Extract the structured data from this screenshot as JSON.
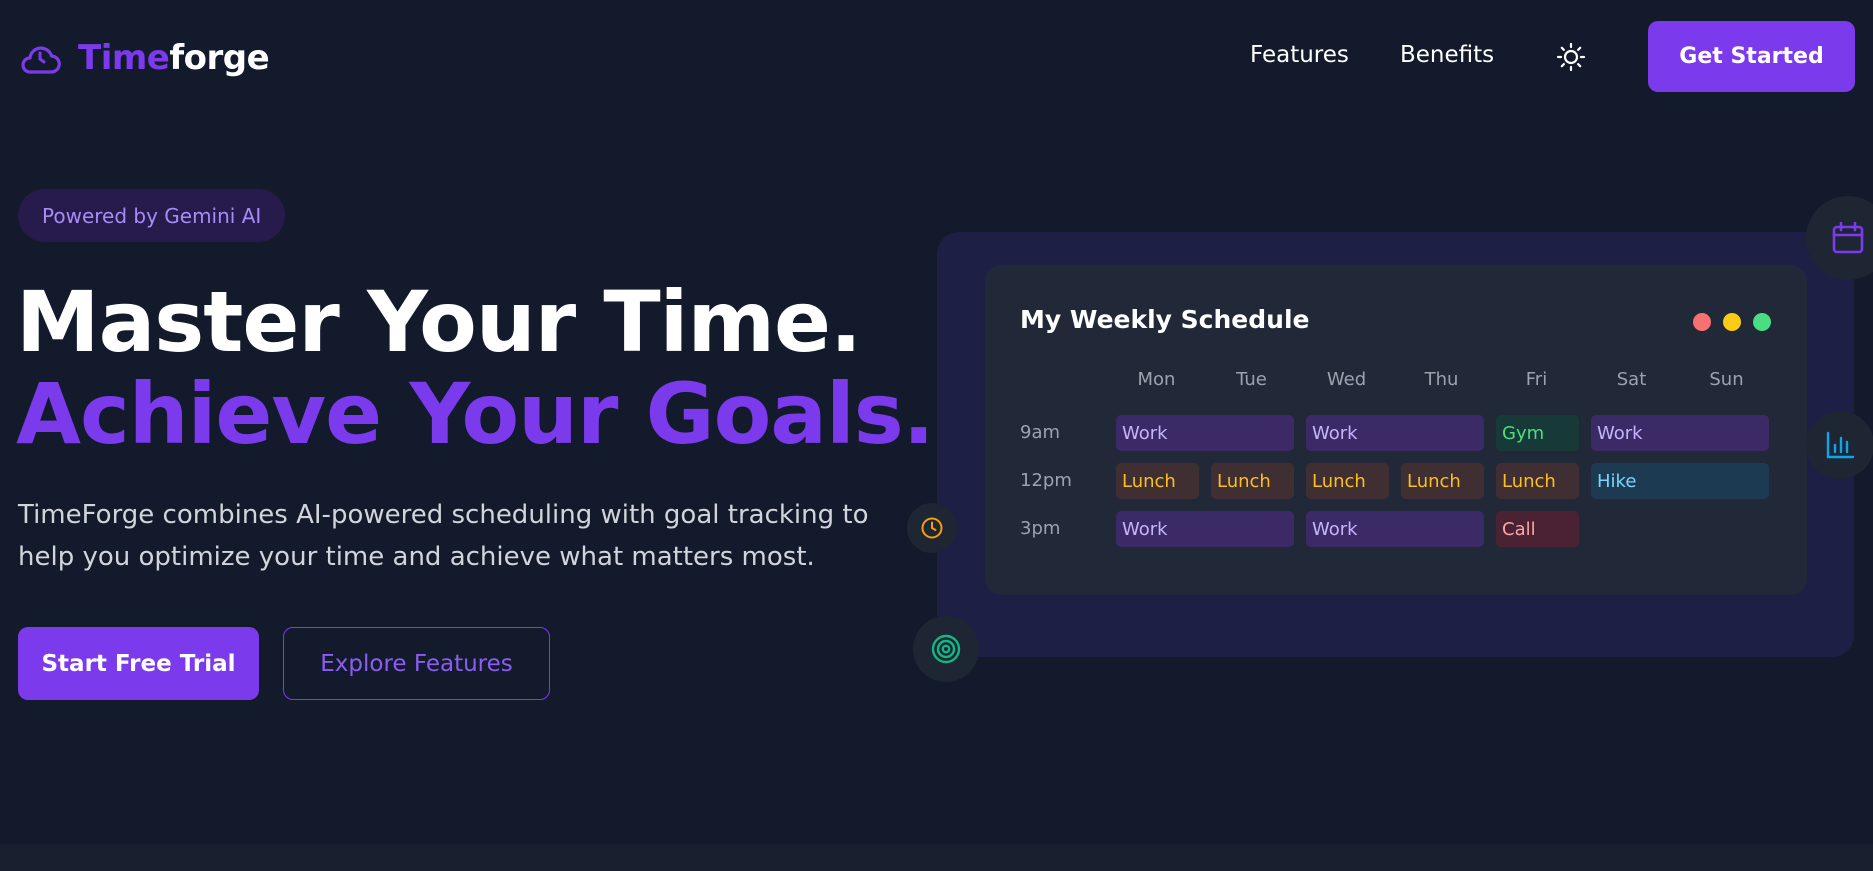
{
  "nav": {
    "logo_part1": "Time",
    "logo_part2": "forge",
    "links": [
      "Features",
      "Benefits"
    ],
    "cta_label": "Get Started"
  },
  "hero": {
    "badge": "Powered by Gemini AI",
    "headline_line1": "Master Your Time.",
    "headline_line2": "Achieve Your Goals.",
    "subtitle": "TimeForge combines AI-powered scheduling with goal tracking to help you optimize your time and achieve what matters most.",
    "primary_button": "Start Free Trial",
    "secondary_button": "Explore Features"
  },
  "schedule": {
    "title": "My Weekly Schedule",
    "days": [
      "Mon",
      "Tue",
      "Wed",
      "Thu",
      "Fri",
      "Sat",
      "Sun"
    ],
    "times": [
      "9am",
      "12pm",
      "3pm"
    ],
    "events": {
      "work_mon_tue_9": "Work",
      "work_wed_thu_9": "Work",
      "gym_fri_9": "Gym",
      "work_sat_sun_9": "Work",
      "lunch_mon": "Lunch",
      "lunch_tue": "Lunch",
      "lunch_wed": "Lunch",
      "lunch_thu": "Lunch",
      "lunch_fri": "Lunch",
      "hike_sat_sun": "Hike",
      "work_mon_tue_3": "Work",
      "work_wed_thu_3": "Work",
      "call_fri": "Call"
    }
  },
  "colors": {
    "accent": "#7c3aed",
    "background": "#131a2b",
    "window_dots": [
      "#f87171",
      "#facc15",
      "#4ade80"
    ]
  },
  "icons": [
    "cloud-logo-icon",
    "sun-icon",
    "calendar-icon",
    "bar-chart-icon",
    "clock-icon",
    "target-icon"
  ]
}
